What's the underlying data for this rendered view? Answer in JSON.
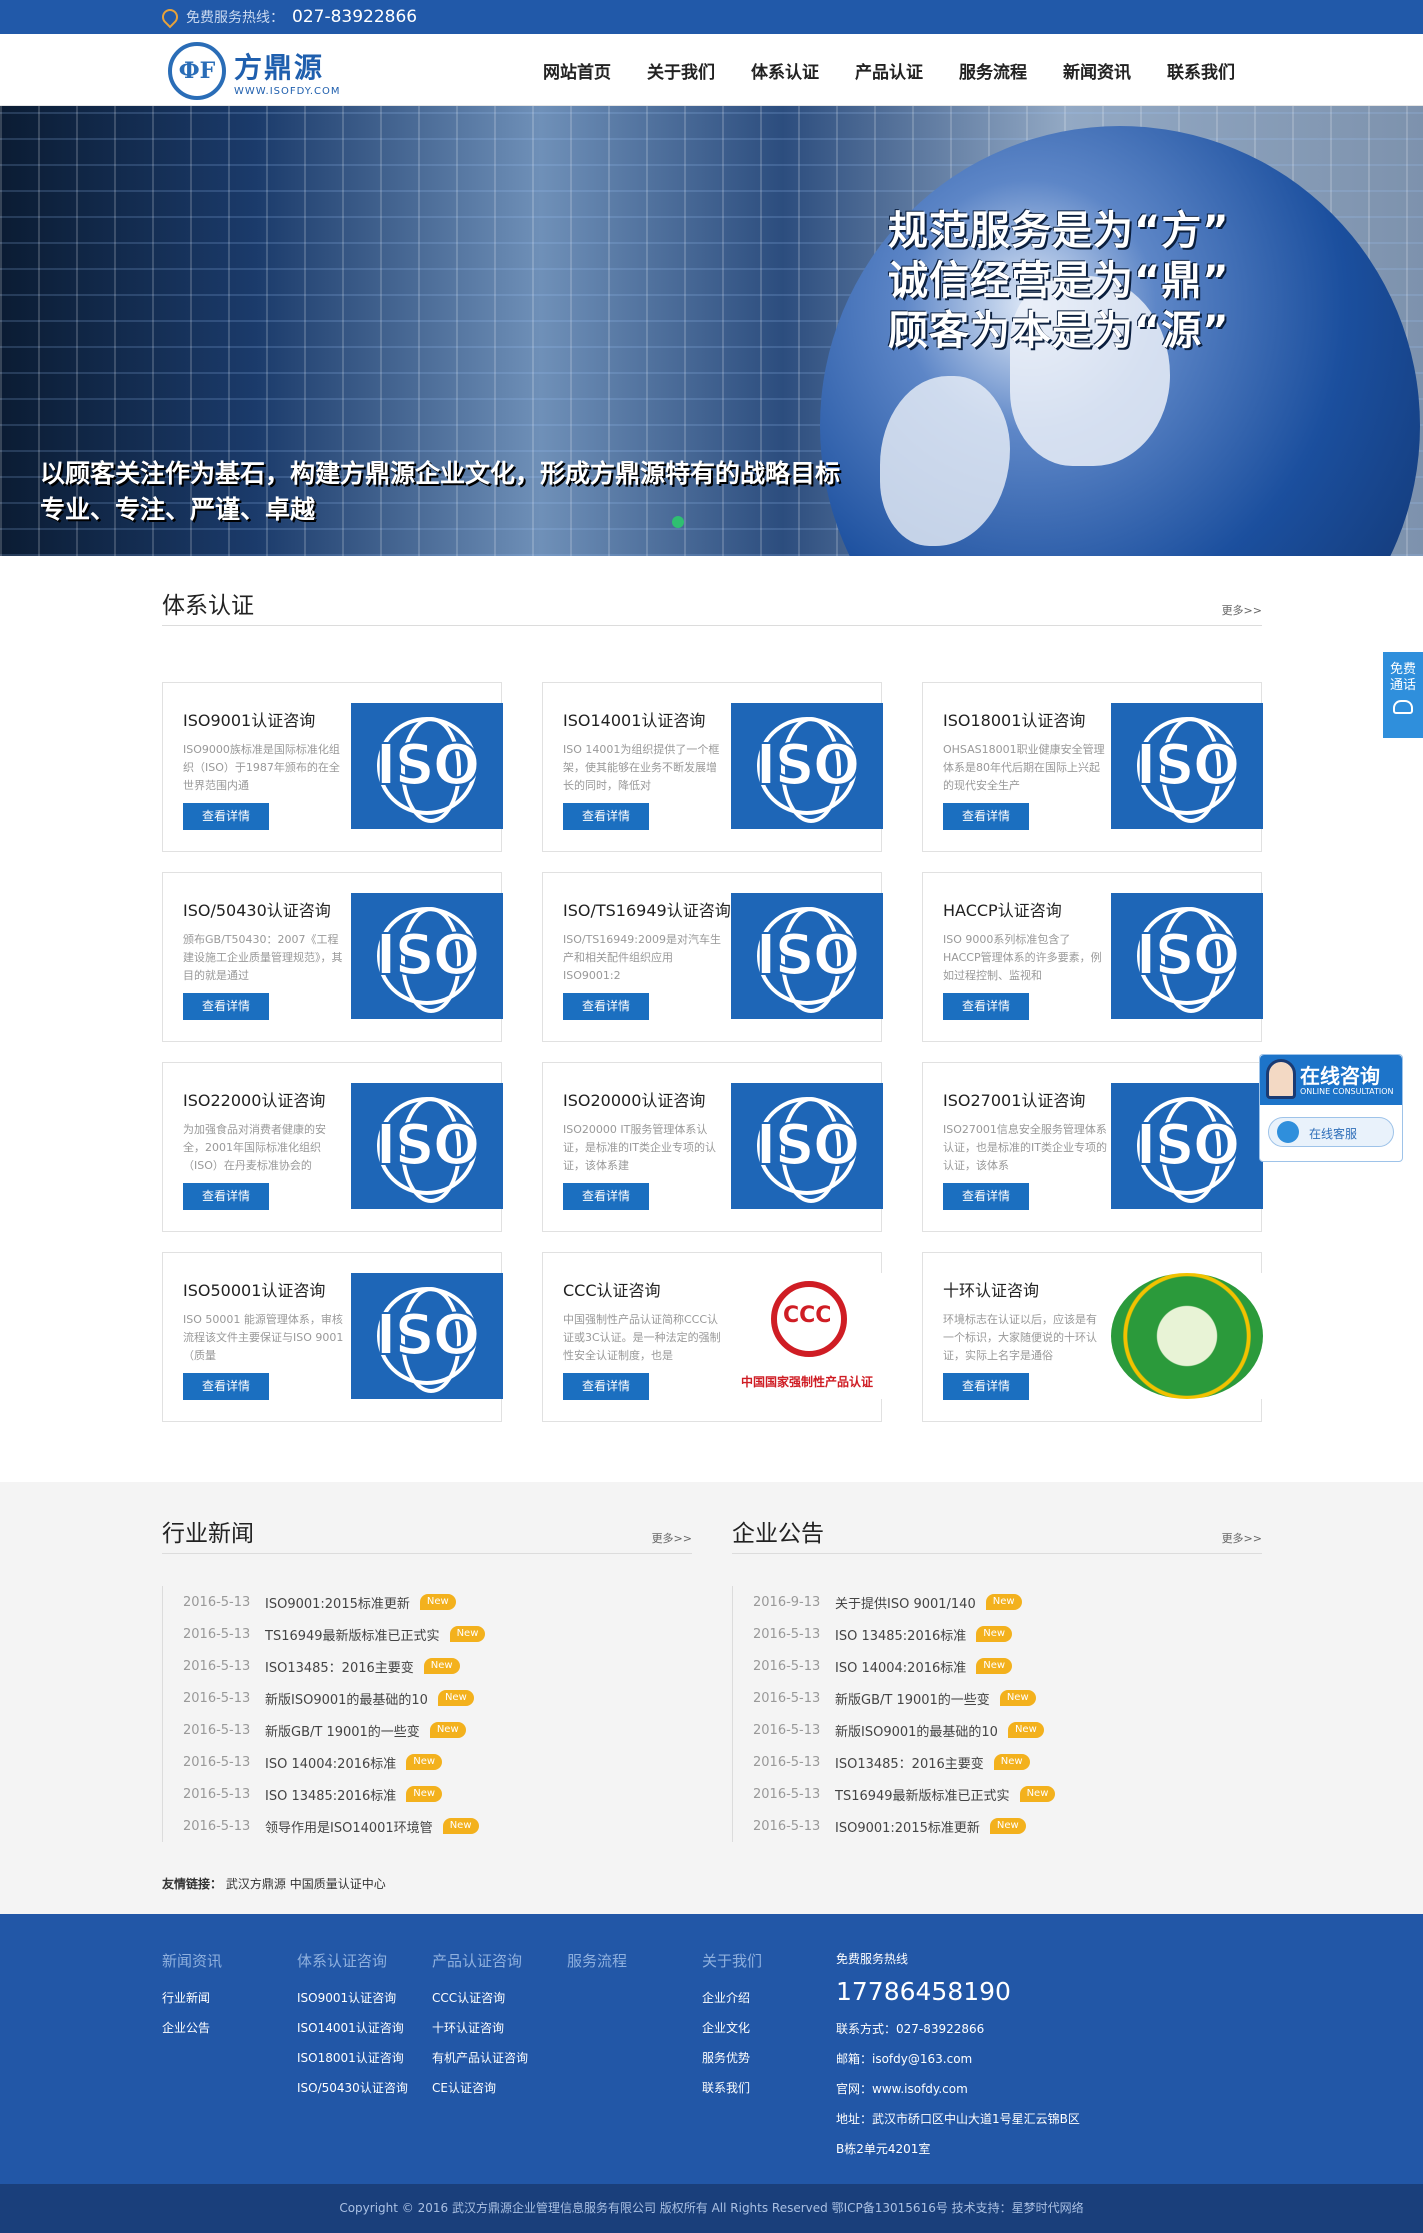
{
  "topbar": {
    "hot_label": "免费服务热线：",
    "hot_number": "027-83922866"
  },
  "header": {
    "logo_mark": "ФF",
    "logo_cn": "方鼎源",
    "logo_en": "WWW.ISOFDY.COM",
    "nav": [
      "网站首页",
      "关于我们",
      "体系认证",
      "产品认证",
      "服务流程",
      "新闻资讯",
      "联系我们"
    ]
  },
  "banner": {
    "slogan": [
      "规范服务是为“方”",
      "诚信经营是为“鼎”",
      "顾客为本是为“源”"
    ],
    "lines": [
      "以顾客关注作为基石，构建方鼎源企业文化，形成方鼎源特有的战略目标",
      "专业、专注、严谨、卓越"
    ]
  },
  "certification": {
    "title": "体系认证",
    "more": "更多>>",
    "button_label": "查看详情",
    "iso_word": "ISO",
    "cards": [
      {
        "title": "ISO9001认证咨询",
        "desc": "ISO9000族标准是国际标准化组织（ISO）于1987年颁布的在全世界范围内通",
        "logo": "iso"
      },
      {
        "title": "ISO14001认证咨询",
        "desc": "ISO 14001为组织提供了一个框架，使其能够在业务不断发展增长的同时，降低对",
        "logo": "iso"
      },
      {
        "title": "ISO18001认证咨询",
        "desc": "OHSAS18001职业健康安全管理体系是80年代后期在国际上兴起的现代安全生产",
        "logo": "iso"
      },
      {
        "title": "ISO/50430认证咨询",
        "desc": "颁布GB/T50430：2007《工程建设施工企业质量管理规范》，其目的就是通过",
        "logo": "iso"
      },
      {
        "title": "ISO/TS16949认证咨询",
        "desc": "ISO/TS16949:2009是对汽车生产和相关配件组织应用ISO9001:2",
        "logo": "iso"
      },
      {
        "title": "HACCP认证咨询",
        "desc": "ISO 9000系列标准包含了HACCP管理体系的许多要素，例如过程控制、监视和",
        "logo": "iso"
      },
      {
        "title": "ISO22000认证咨询",
        "desc": "为加强食品对消费者健康的安全，2001年国际标准化组织（ISO）在丹麦标准协会的",
        "logo": "iso"
      },
      {
        "title": "ISO20000认证咨询",
        "desc": "ISO20000 IT服务管理体系认证，是标准的IT类企业专项的认证，该体系建",
        "logo": "iso"
      },
      {
        "title": "ISO27001认证咨询",
        "desc": "ISO27001信息安全服务管理体系认证，也是标准的IT类企业专项的认证，该体系",
        "logo": "iso"
      },
      {
        "title": "ISO50001认证咨询",
        "desc": "ISO 50001 能源管理体系，审核流程该文件主要保证与ISO 9001（质量",
        "logo": "iso"
      },
      {
        "title": "CCC认证咨询",
        "desc": "中国强制性产品认证简称CCC认证或3C认证。是一种法定的强制性安全认证制度，也是",
        "logo": "ccc",
        "logo_text": "中国国家强制性产品认证"
      },
      {
        "title": "十环认证咨询",
        "desc": "环境标志在认证以后，应该是有一个标识，大家随便说的十环认证，实际上名字是通俗",
        "logo": "env"
      }
    ]
  },
  "industry_news": {
    "title": "行业新闻",
    "more": "更多>>",
    "badge": "New",
    "items": [
      {
        "date": "2016-5-13",
        "title": "ISO9001:2015标准更新"
      },
      {
        "date": "2016-5-13",
        "title": "TS16949最新版标准已正式实"
      },
      {
        "date": "2016-5-13",
        "title": "ISO13485：2016主要变"
      },
      {
        "date": "2016-5-13",
        "title": "新版ISO9001的最基础的10"
      },
      {
        "date": "2016-5-13",
        "title": "新版GB/T 19001的一些变"
      },
      {
        "date": "2016-5-13",
        "title": "ISO 14004:2016标准"
      },
      {
        "date": "2016-5-13",
        "title": "ISO 13485:2016标准"
      },
      {
        "date": "2016-5-13",
        "title": "领导作用是ISO14001环境管"
      }
    ]
  },
  "company_notice": {
    "title": "企业公告",
    "more": "更多>>",
    "badge": "New",
    "items": [
      {
        "date": "2016-9-13",
        "title": "关于提供ISO 9001/140"
      },
      {
        "date": "2016-5-13",
        "title": "ISO 13485:2016标准"
      },
      {
        "date": "2016-5-13",
        "title": "ISO 14004:2016标准"
      },
      {
        "date": "2016-5-13",
        "title": "新版GB/T 19001的一些变"
      },
      {
        "date": "2016-5-13",
        "title": "新版ISO9001的最基础的10"
      },
      {
        "date": "2016-5-13",
        "title": "ISO13485：2016主要变"
      },
      {
        "date": "2016-5-13",
        "title": "TS16949最新版标准已正式实"
      },
      {
        "date": "2016-5-13",
        "title": "ISO9001:2015标准更新"
      }
    ]
  },
  "friend_links": {
    "label": "友情链接：",
    "links": [
      "武汉方鼎源",
      "中国质量认证中心"
    ]
  },
  "footer": {
    "columns": [
      {
        "head": "新闻资讯",
        "links": [
          "行业新闻",
          "企业公告"
        ]
      },
      {
        "head": "体系认证咨询",
        "links": [
          "ISO9001认证咨询",
          "ISO14001认证咨询",
          "ISO18001认证咨询",
          "ISO/50430认证咨询"
        ]
      },
      {
        "head": "产品认证咨询",
        "links": [
          "CCC认证咨询",
          "十环认证咨询",
          "有机产品认证咨询",
          "CE认证咨询"
        ]
      },
      {
        "head": "服务流程",
        "links": []
      },
      {
        "head": "关于我们",
        "links": [
          "企业介绍",
          "企业文化",
          "服务优势",
          "联系我们"
        ]
      }
    ],
    "contact": {
      "label": "免费服务热线",
      "big_number": "17786458190",
      "lines": [
        "联系方式：027-83922866",
        "邮箱：isofdy@163.com",
        "官网：www.isofdy.com",
        "地址：武汉市硚口区中山大道1号星汇云锦B区",
        "B栋2单元4201室"
      ]
    },
    "copyright": "Copyright © 2016 武汉方鼎源企业管理信息服务有限公司 版权所有 All Rights Reserved 鄂ICP备13015616号 技术支持：星梦时代网络"
  },
  "floating": {
    "call_text": "免费通话",
    "consult_title": "在线咨询",
    "consult_sub": "ONLINE CONSULTATION",
    "service_label": "在线客服"
  }
}
